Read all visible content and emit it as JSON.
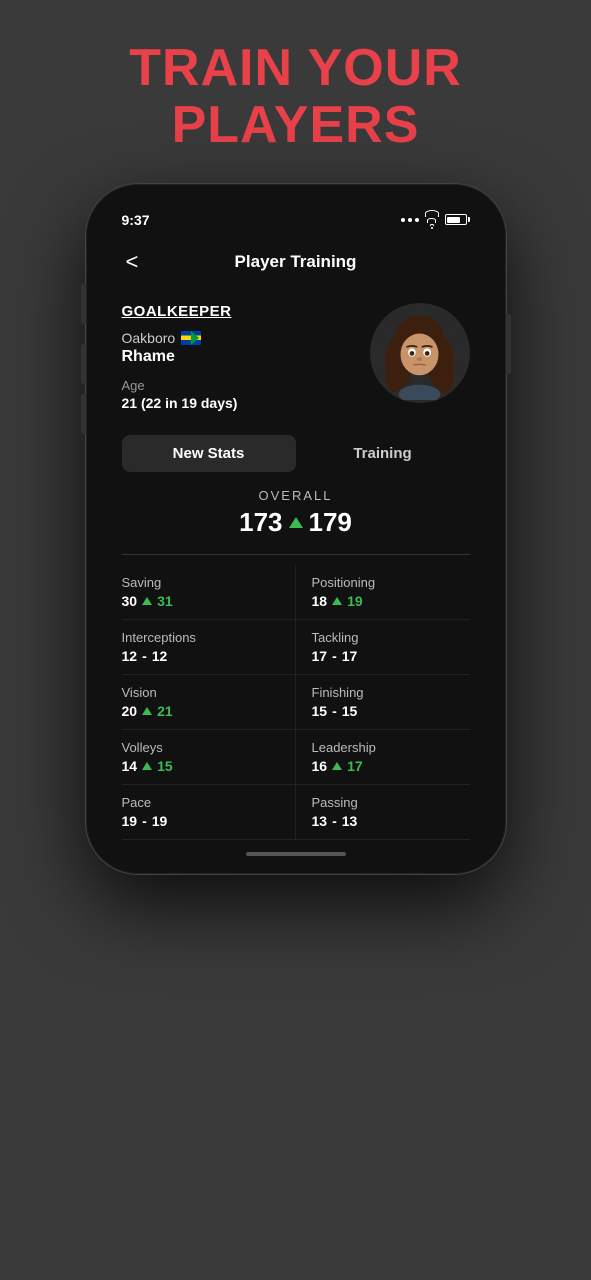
{
  "headline": {
    "line1": "TRAIN YOUR",
    "line2": "PLAYERS"
  },
  "status": {
    "time": "9:37",
    "signal": "...",
    "wifi": "wifi",
    "battery": "battery"
  },
  "nav": {
    "back_label": "<",
    "title": "Player Training"
  },
  "player": {
    "position": "GOALKEEPER",
    "club": "Oakboro",
    "name": "Rhame",
    "age_label": "Age",
    "age_value": "21 (22 in 19 days)"
  },
  "tabs": [
    {
      "id": "new-stats",
      "label": "New Stats",
      "active": true
    },
    {
      "id": "training",
      "label": "Training",
      "active": false
    }
  ],
  "overall": {
    "label": "OVERALL",
    "old_value": "173",
    "new_value": "179"
  },
  "stats": [
    {
      "name": "Saving",
      "old": "30",
      "new": "31",
      "changed": true
    },
    {
      "name": "Positioning",
      "old": "18",
      "new": "19",
      "changed": true
    },
    {
      "name": "Interceptions",
      "old": "12",
      "new": "12",
      "changed": false
    },
    {
      "name": "Tackling",
      "old": "17",
      "new": "17",
      "changed": false
    },
    {
      "name": "Vision",
      "old": "20",
      "new": "21",
      "changed": true
    },
    {
      "name": "Finishing",
      "old": "15",
      "new": "15",
      "changed": false
    },
    {
      "name": "Volleys",
      "old": "14",
      "new": "15",
      "changed": true
    },
    {
      "name": "Leadership",
      "old": "16",
      "new": "17",
      "changed": true
    },
    {
      "name": "Pace",
      "old": "19",
      "new": "19",
      "changed": false
    },
    {
      "name": "Passing",
      "old": "13",
      "new": "13",
      "changed": false
    }
  ]
}
